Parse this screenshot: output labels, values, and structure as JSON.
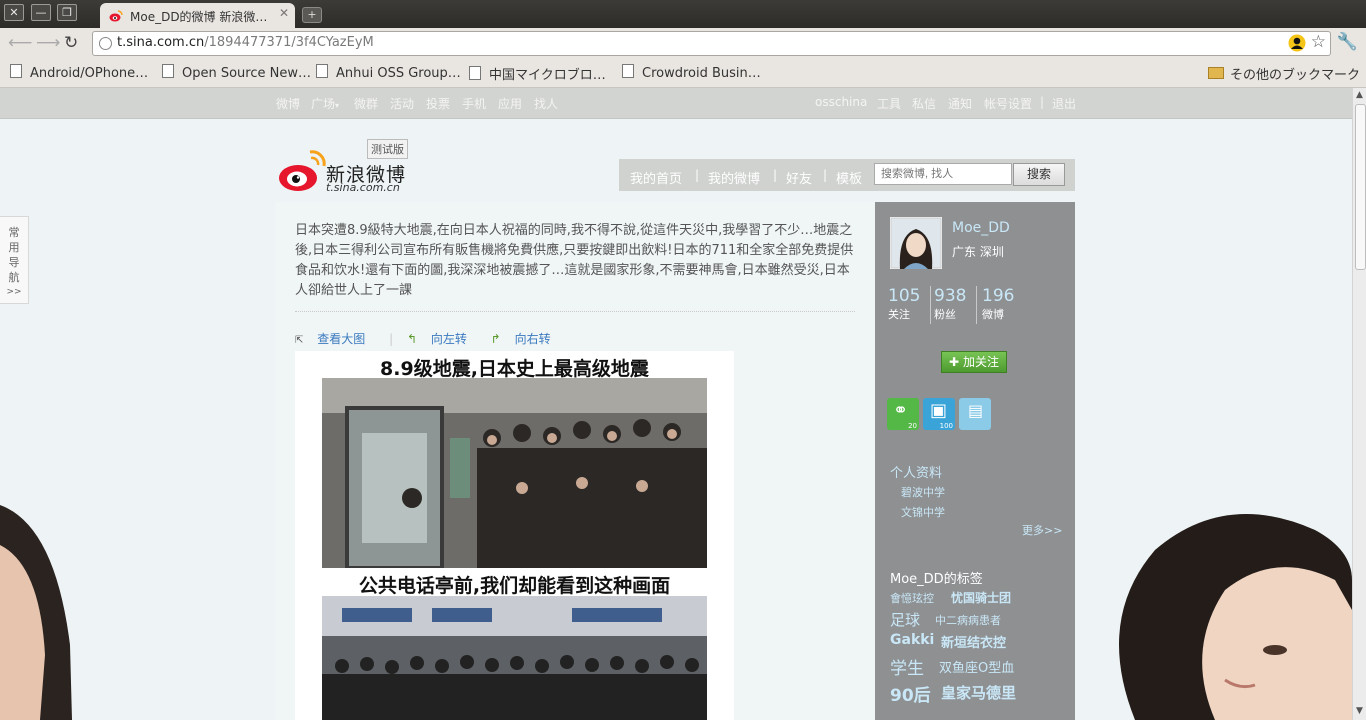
{
  "browser": {
    "tab_title": "Moe_DD的微博 新浪微…",
    "url_host": "t.sina.com.cn",
    "url_path": "/1894477371/3f4CYazEyM",
    "bookmarks": [
      "Android/OPhone…",
      "Open Source New…",
      "Anhui OSS Group…",
      "中国マイクロブロ…",
      "Crowdroid Busin…"
    ],
    "other_bookmarks": "その他のブックマーク"
  },
  "topnav": {
    "left": [
      "微博",
      "广场",
      "微群",
      "活动",
      "投票",
      "手机",
      "应用",
      "找人"
    ],
    "right": [
      "osschina",
      "工具",
      "私信",
      "通知",
      "帐号设置",
      "退出"
    ]
  },
  "sidebar_tab": "常用导航",
  "sidebar_tab_more": ">>",
  "logo": {
    "name": "新浪微博",
    "domain": "t.sina.com.cn",
    "beta": "测试版"
  },
  "mainnav": {
    "items": [
      "我的首页",
      "我的微博",
      "好友",
      "模板"
    ],
    "search_placeholder": "搜索微博, 找人",
    "search_button": "搜索"
  },
  "post": {
    "text": "日本突遭8.9級特大地震,在向日本人祝福的同時,我不得不說,從這件天災中,我學習了不少…地震之後,日本三得利公司宣布所有販售機將免費供應,只要按鍵即出飲料!日本的711和全家全部免费提供食品和饮水!還有下面的圖,我深深地被震撼了…這就是國家形象,不需要神馬會,日本雖然受災,日本人卻給世人上了一課",
    "view_large": "查看大图",
    "rotate_left": "向左转",
    "rotate_right": "向右转",
    "image_caption_top": "8.9级地震,日本史上最高级地震",
    "image_caption_mid": "公共电话亭前,我们却能看到这种画面"
  },
  "profile": {
    "name": "Moe_DD",
    "location": "广东  深圳",
    "stats": [
      {
        "value": "105",
        "label": "关注"
      },
      {
        "value": "938",
        "label": "粉丝"
      },
      {
        "value": "196",
        "label": "微博"
      }
    ],
    "follow_button": "加关注",
    "badges": [
      {
        "count": "20",
        "color": "#54b847"
      },
      {
        "count": "100",
        "color": "#3aa4d8"
      },
      {
        "count": "",
        "color": "#8ccbe8"
      }
    ],
    "info_heading": "个人资料",
    "schools": [
      "碧波中学",
      "文锦中学"
    ],
    "more": "更多>>",
    "tags_heading": "Moe_DD的标签",
    "tags": [
      [
        "會憶玹控",
        "忧国骑士团"
      ],
      [
        "足球",
        "中二病病患者"
      ],
      [
        "Gakki",
        "新垣结衣控"
      ],
      [
        "学生",
        "双鱼座O型血"
      ],
      [
        "90后",
        "皇家马德里"
      ]
    ]
  }
}
